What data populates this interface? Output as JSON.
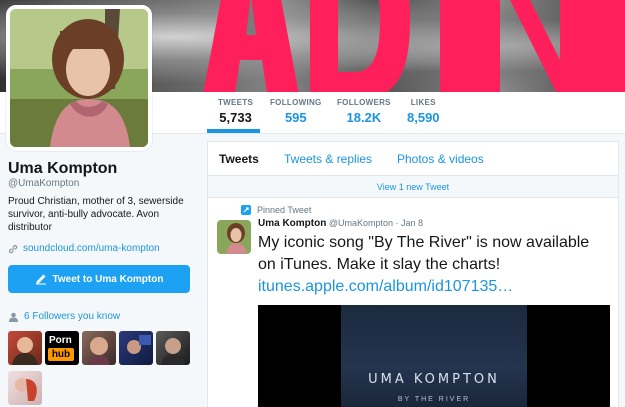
{
  "profile": {
    "name": "Uma Kompton",
    "handle": "@UmaKompton",
    "bio": "Proud Christian, mother of 3, sewerside survivor, anti-bully advocate. Avon distributor",
    "link": "soundcloud.com/uma-kompton",
    "tweet_to_label": "Tweet to Uma Kompton",
    "followers_you_know": "6 Followers you know",
    "follower_thumbs": [
      "porn-hub-thumb",
      "person-thumb"
    ]
  },
  "stats": [
    {
      "label": "TWEETS",
      "value": "5,733"
    },
    {
      "label": "FOLLOWING",
      "value": "595"
    },
    {
      "label": "FOLLOWERS",
      "value": "18.2K"
    },
    {
      "label": "LIKES",
      "value": "8,590"
    }
  ],
  "thumbs": {
    "pornhub": {
      "word1": "Porn",
      "word2": "hub"
    }
  },
  "timeline": {
    "tabs": [
      "Tweets",
      "Tweets & replies",
      "Photos & videos"
    ],
    "new_tweet_bar": "View 1 new Tweet",
    "pinned_label": "Pinned Tweet",
    "tweet": {
      "author": "Uma Kompton",
      "handle": "@UmaKompton",
      "date": "· Jan 8",
      "text": "My iconic song \"By The River\" is now available on iTunes. Make it slay the charts!",
      "link": "itunes.apple.com/album/id107135…",
      "media_title": "UMA KOMPTON",
      "media_subtitle": "BY THE RIVER"
    }
  },
  "colors": {
    "accent": "#1da1f2",
    "link": "#1b95e0",
    "banner_letters": "#ff1f5a"
  }
}
